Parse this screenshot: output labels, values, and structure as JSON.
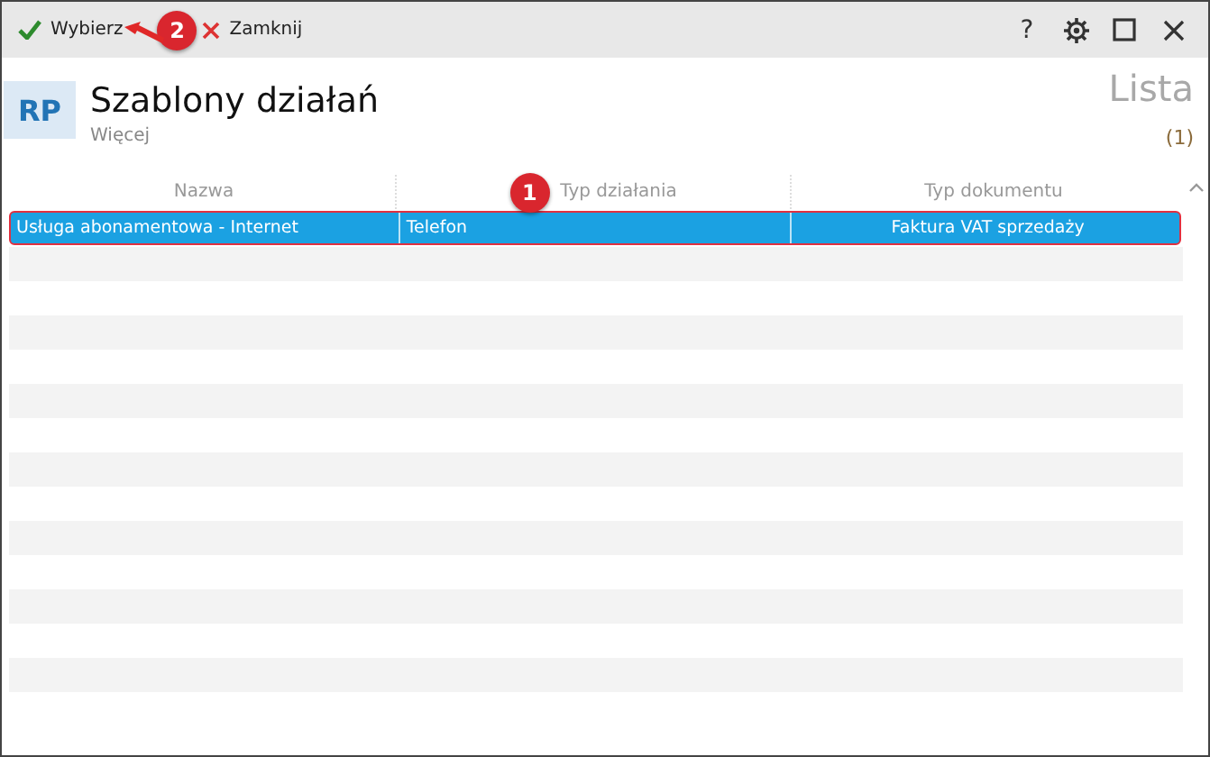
{
  "toolbar": {
    "buttons": [
      {
        "kind": "confirm",
        "label": "Wybierz"
      },
      {
        "kind": "close",
        "label": "Zamknij"
      }
    ],
    "window_controls": [
      {
        "kind": "help",
        "label": "?"
      },
      {
        "kind": "settings"
      },
      {
        "kind": "maximize"
      },
      {
        "kind": "close"
      }
    ]
  },
  "header": {
    "badge": "RP",
    "title": "Szablony działań",
    "subtitle": "Więcej",
    "view": "Lista",
    "count": "(1)"
  },
  "table": {
    "columns": [
      "Nazwa",
      "Typ działania",
      "Typ dokumentu"
    ],
    "rows": [
      {
        "cells": [
          "Usługa abonamentowa - Internet",
          "Telefon",
          "Faktura VAT sprzedaży"
        ],
        "selected": true
      }
    ]
  },
  "annotations": [
    {
      "label": "2"
    },
    {
      "label": "1"
    }
  ]
}
